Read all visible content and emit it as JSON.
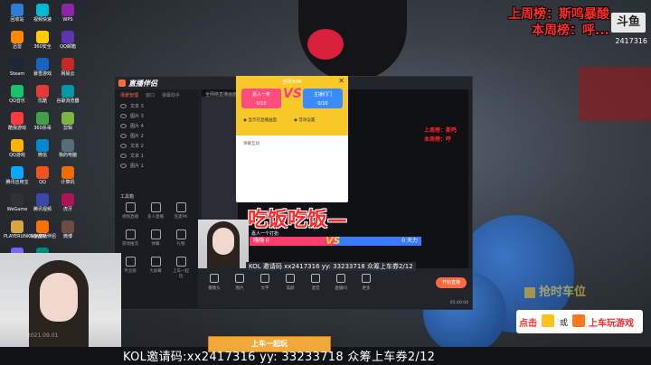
{
  "desktop": {
    "icons": [
      "回收站",
      "迅雷",
      "Steam",
      "QQ音乐",
      "酷我游戏",
      "QQ游戏",
      "腾讯应用宝",
      "WeGame",
      "PLAYERUNKNOWN",
      "PLAYER...",
      "视频快速",
      "360安全",
      "暴雪游戏",
      "优酷",
      "360杀毒",
      "微信",
      "QQ",
      "腾讯视频",
      "斗鱼直播伴侣",
      "QQ浏览器",
      "WPS",
      "QQ邮箱",
      "网易云",
      "谷歌浏览器",
      "剪辑",
      "我的电脑",
      "计算机",
      "虎牙",
      "微博"
    ],
    "colors": [
      "#2e7dd7",
      "#ff8a00",
      "#1b2838",
      "#18c46a",
      "#ff3b3b",
      "#ffb300",
      "#0aa6ff",
      "#2e3238",
      "#d9a441",
      "#7b61ff",
      "#00b8d4",
      "#ffcc00",
      "#1565c0",
      "#e53935",
      "#43a047",
      "#0288d1",
      "#f4511e",
      "#3949ab",
      "#ff6f00",
      "#00897b",
      "#8e24aa",
      "#5e35b1",
      "#c62828",
      "#0097a7",
      "#7cb342",
      "#546e7a",
      "#ef6c00",
      "#ad1457",
      "#6d4c41"
    ]
  },
  "rank": {
    "line1": "上周榜：斯鸣暴酸",
    "line2": "本周榜：呼...",
    "logo": "斗鱼",
    "room": "2417316"
  },
  "app": {
    "name": "直播伴侣",
    "tabs": [
      "场景管理",
      "窗口",
      "弹幕助手"
    ],
    "sources": [
      "文本 3",
      "图片 3",
      "图片 4",
      "图片 2",
      "文本 2",
      "文本 1",
      "图片 1"
    ],
    "tools_title": "工具箱",
    "tools": [
      "视频直播",
      "多人直播",
      "连麦PK",
      "游戏推流",
      "弹幕",
      "礼物",
      "专业版",
      "大屏幕",
      "上车一起玩"
    ],
    "stage_title": "全网络直播画面",
    "toolbar": [
      "摄像头",
      "图片",
      "文字",
      "美颜",
      "混音",
      "直播间",
      "更多"
    ],
    "golive": "开始直播",
    "time": "05:40:04"
  },
  "pk": {
    "title": "全网大PK",
    "team_a": "嘉人一家",
    "team_b": "主播们门",
    "score_a": "0/10",
    "score_b": "0/10",
    "opt1": "显示在直播画面",
    "opt2": "音效设置",
    "body": "弹幕互动"
  },
  "overlay": {
    "bigtext": "吃饭吃饭—",
    "pk_left": "嘉人一个打扮",
    "pk_left_val": "嗨嗨 0",
    "pk_right_val": "0 天力",
    "vs": "VS",
    "mini_rank1": "上周榜：斯鸣",
    "mini_rank2": "本周榜：呼",
    "date1": "2021.09.01",
    "room_small": "2417316"
  },
  "ticker": "KOL邀请码:xx2417316 yy: 33233718  众筹上车券2/12",
  "ticker_small": "KOL 邀请码 xx2417316 yy: 33233718  众筹上车券2/12",
  "shangche": "上车一起玩",
  "promo": {
    "t1": "点击",
    "t2": "或",
    "t3": "上车玩游戏"
  },
  "seat": "抢时车位"
}
